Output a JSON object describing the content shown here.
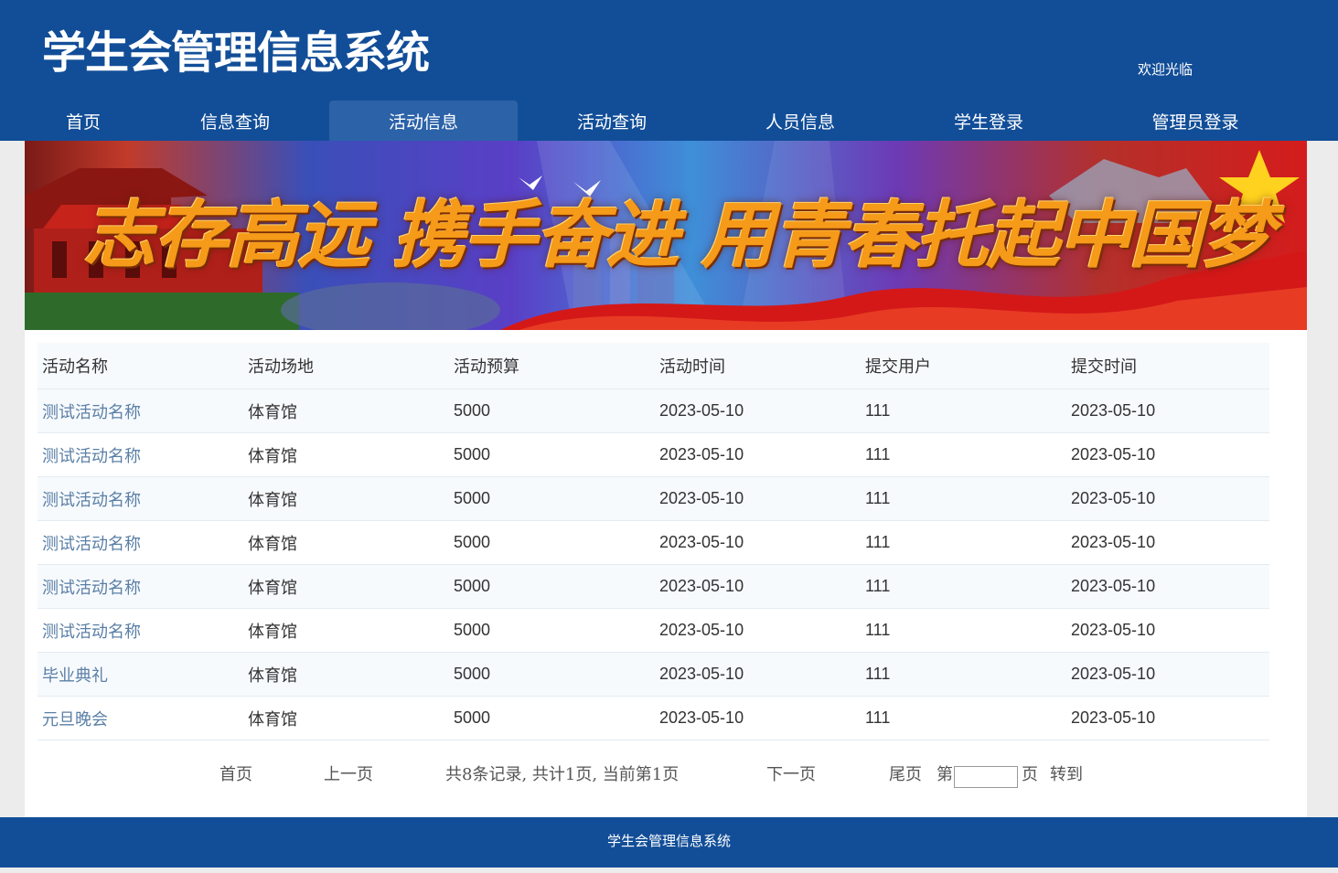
{
  "header": {
    "title": "学生会管理信息系统",
    "welcome": "欢迎光临"
  },
  "nav": {
    "items": [
      {
        "label": "首页"
      },
      {
        "label": "信息查询"
      },
      {
        "label": "活动信息"
      },
      {
        "label": "活动查询"
      },
      {
        "label": "人员信息"
      },
      {
        "label": "学生登录"
      },
      {
        "label": "管理员登录"
      }
    ],
    "active": "活动信息"
  },
  "banner": {
    "slogan": "志存高远 携手奋进 用青春托起中国梦"
  },
  "table": {
    "columns": [
      "活动名称",
      "活动场地",
      "活动预算",
      "活动时间",
      "提交用户",
      "提交时间"
    ],
    "rows": [
      {
        "name": "测试活动名称",
        "venue": "体育馆",
        "budget": "5000",
        "date": "2023-05-10",
        "user": "111",
        "submitted": "2023-05-10"
      },
      {
        "name": "测试活动名称",
        "venue": "体育馆",
        "budget": "5000",
        "date": "2023-05-10",
        "user": "111",
        "submitted": "2023-05-10"
      },
      {
        "name": "测试活动名称",
        "venue": "体育馆",
        "budget": "5000",
        "date": "2023-05-10",
        "user": "111",
        "submitted": "2023-05-10"
      },
      {
        "name": "测试活动名称",
        "venue": "体育馆",
        "budget": "5000",
        "date": "2023-05-10",
        "user": "111",
        "submitted": "2023-05-10"
      },
      {
        "name": "测试活动名称",
        "venue": "体育馆",
        "budget": "5000",
        "date": "2023-05-10",
        "user": "111",
        "submitted": "2023-05-10"
      },
      {
        "name": "测试活动名称",
        "venue": "体育馆",
        "budget": "5000",
        "date": "2023-05-10",
        "user": "111",
        "submitted": "2023-05-10"
      },
      {
        "name": "毕业典礼",
        "venue": "体育馆",
        "budget": "5000",
        "date": "2023-05-10",
        "user": "111",
        "submitted": "2023-05-10"
      },
      {
        "name": "元旦晚会",
        "venue": "体育馆",
        "budget": "5000",
        "date": "2023-05-10",
        "user": "111",
        "submitted": "2023-05-10"
      }
    ]
  },
  "pager": {
    "first": "首页",
    "prev": "上一页",
    "summary": "共8条记录, 共计1页, 当前第1页",
    "next": "下一页",
    "last": "尾页",
    "page_prefix": "第",
    "page_suffix": "页",
    "goto": "转到",
    "page_input_value": ""
  },
  "footer": {
    "text": "学生会管理信息系统"
  }
}
